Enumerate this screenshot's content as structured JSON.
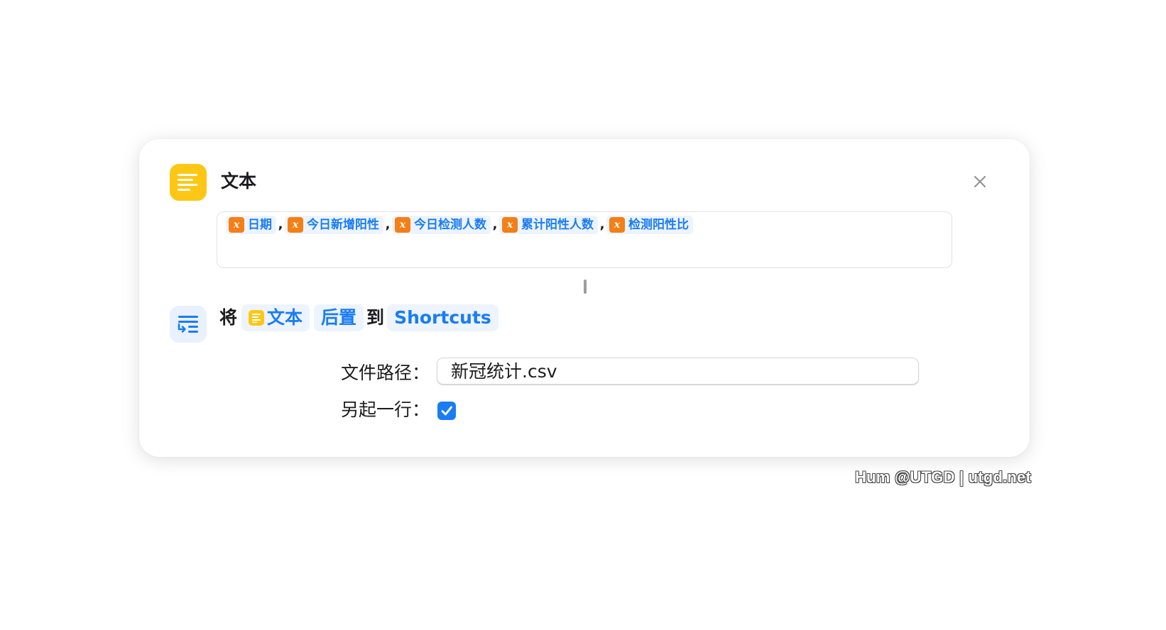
{
  "text_action": {
    "title": "文本",
    "icon": "text-document-icon",
    "tokens": [
      {
        "variable": "日期",
        "separator": ","
      },
      {
        "variable": "今日新增阳性",
        "separator": ","
      },
      {
        "variable": "今日检测人数",
        "separator": ","
      },
      {
        "variable": "累计阳性人数",
        "separator": ","
      },
      {
        "variable": "检测阳性比",
        "separator": ""
      }
    ]
  },
  "append_action": {
    "icon": "append-lines-icon",
    "word_jiang": "将",
    "input_label": "文本",
    "mode_label": "后置",
    "word_dao": "到",
    "target_label": "Shortcuts",
    "file_path_label": "文件路径：",
    "file_path_value": "新冠统计.csv",
    "new_line_label": "另起一行：",
    "new_line_checked": true
  },
  "colors": {
    "accent": "#1a7cf5",
    "text_icon_bg": "#ffc715",
    "variable_icon_bg": "#f57f17"
  },
  "watermark": "Hum @UTGD | utgd.net"
}
